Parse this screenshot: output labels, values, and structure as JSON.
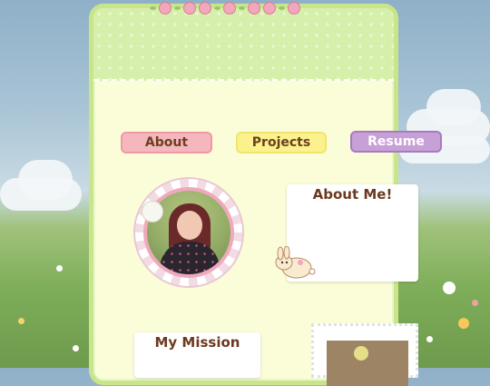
{
  "nav": {
    "about_label": "About",
    "projects_label": "Projects",
    "resume_label": "Resume"
  },
  "cards": {
    "about_title": "About Me!",
    "mission_title": "My Mission"
  },
  "colors": {
    "panel_bg": "#fbfdd9",
    "panel_border": "#c8e58b",
    "about_btn": "#f6b6bd",
    "projects_btn": "#fbf28d",
    "resume_btn": "#c8a0d8",
    "title_text": "#6b3a1e"
  },
  "icons": {
    "garland": "rose-garland-icon",
    "bunny": "bunny-sticker-icon"
  }
}
